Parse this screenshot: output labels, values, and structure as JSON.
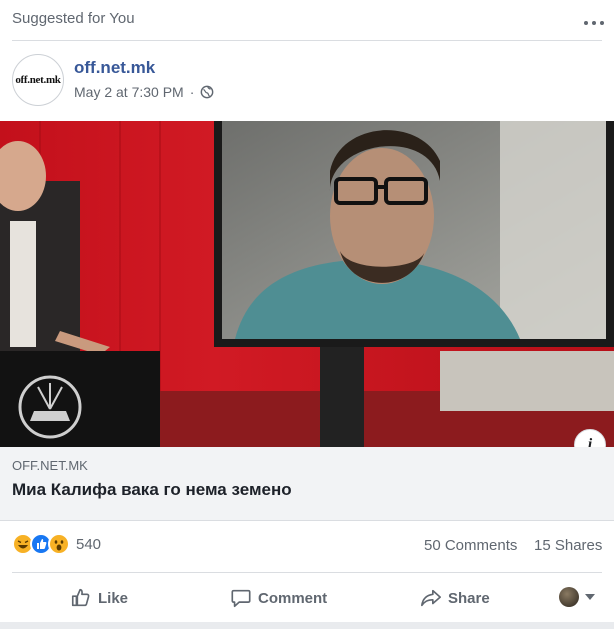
{
  "header": {
    "suggested_label": "Suggested for You"
  },
  "post": {
    "page_name": "off.net.mk",
    "avatar_text": "off.net.mk",
    "timestamp": "May 2 at 7:30 PM"
  },
  "link": {
    "domain": "OFF.NET.MK",
    "title": "Миа Калифа вака го нема земено"
  },
  "stats": {
    "reaction_count": "540",
    "comments": "50 Comments",
    "shares": "15 Shares"
  },
  "actions": {
    "like": "Like",
    "comment": "Comment",
    "share": "Share"
  },
  "icons": {
    "more": "more-dots-icon",
    "globe": "globe-icon",
    "info": "info-icon",
    "like": "thumbs-up-icon",
    "comment": "comment-bubble-icon",
    "share": "share-arrow-icon",
    "caret": "caret-down-icon"
  },
  "info_glyph": "i",
  "colors": {
    "page_link": "#385898",
    "secondary_text": "#606770",
    "link_box_bg": "#f2f3f5",
    "like_blue": "#1877f2",
    "reaction_yellow": "#f7b125"
  }
}
